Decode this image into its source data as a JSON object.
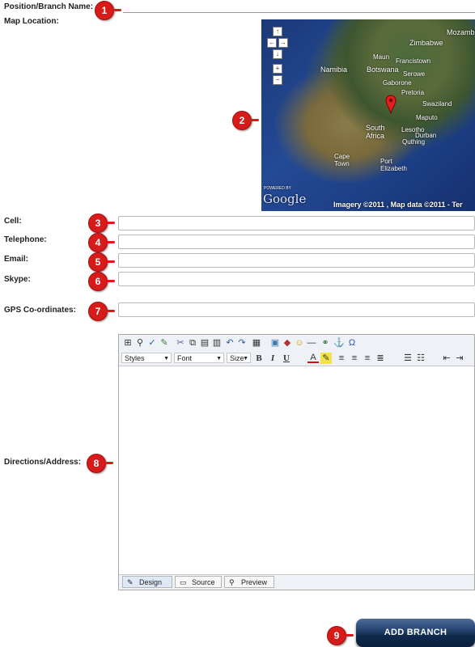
{
  "form": {
    "position_label": "Position/Branch Name:",
    "map_label": "Map Location:",
    "cell_label": "Cell:",
    "telephone_label": "Telephone:",
    "email_label": "Email:",
    "skype_label": "Skype:",
    "gps_label": "GPS Co-ordinates:",
    "directions_label": "Directions/Address:"
  },
  "badges": [
    "1",
    "2",
    "3",
    "4",
    "5",
    "6",
    "7",
    "8",
    "9"
  ],
  "map": {
    "places": [
      "Zimbabwe",
      "Mozambique",
      "Namibia",
      "Botswana",
      "Maun",
      "Francistown",
      "Serowe",
      "Gaborone",
      "Pretoria",
      "Swaziland",
      "Maputo",
      "South Africa",
      "Lesotho",
      "Durban",
      "Quthing",
      "Cape Town",
      "Port Elizabeth"
    ],
    "powered_by": "POWERED BY",
    "google": "Google",
    "attribution": "Imagery ©2011 , Map data ©2011 - Ter"
  },
  "editor": {
    "styles": "Styles",
    "font": "Font",
    "size": "Size",
    "tabs": [
      "Design",
      "Source",
      "Preview"
    ]
  },
  "add_button": "ADD BRANCH"
}
